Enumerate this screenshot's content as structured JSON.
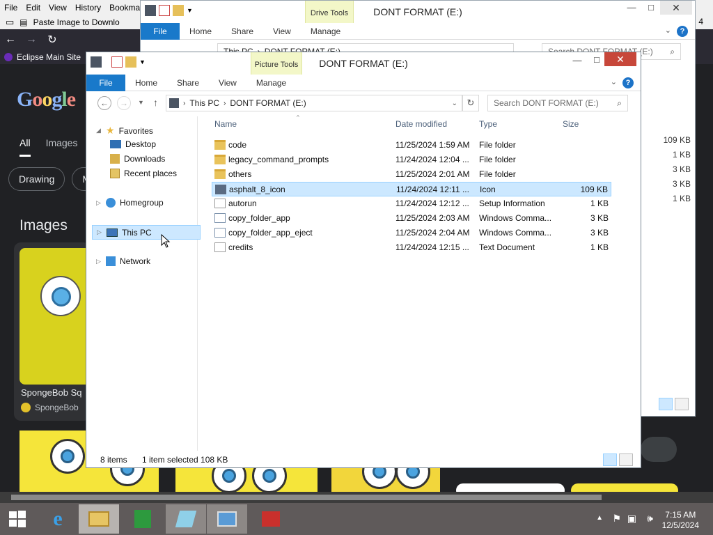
{
  "browser": {
    "menu": [
      "File",
      "Edit",
      "View",
      "History",
      "Bookma"
    ],
    "tab_title": "Paste Image to Downlo",
    "tab_count": "4",
    "bookmark": "Eclipse Main Site",
    "google": {
      "logo": "Google",
      "tabs": [
        "All",
        "Images"
      ],
      "chips": [
        "Drawing",
        "M"
      ],
      "section": "Images",
      "card_caption": "SpongeBob Sq",
      "card_source": "SpongeBob"
    }
  },
  "back_window": {
    "title": "DONT FORMAT (E:)",
    "context_tab": "Drive Tools",
    "ribbon": {
      "file": "File",
      "tabs": [
        "Home",
        "Share",
        "View",
        "Manage"
      ]
    },
    "address": [
      "This PC",
      "DONT FORMAT (E:)"
    ],
    "search_placeholder": "Search DONT FORMAT (E:)",
    "sizes": [
      "109 KB",
      "1 KB",
      "3 KB",
      "3 KB",
      "1 KB"
    ]
  },
  "window": {
    "title": "DONT FORMAT (E:)",
    "context_tab": "Picture Tools",
    "ribbon": {
      "file": "File",
      "tabs": [
        "Home",
        "Share",
        "View",
        "Manage"
      ]
    },
    "address": [
      "This PC",
      "DONT FORMAT (E:)"
    ],
    "search_placeholder": "Search DONT FORMAT (E:)",
    "nav": {
      "favorites": "Favorites",
      "desktop": "Desktop",
      "downloads": "Downloads",
      "recent": "Recent places",
      "homegroup": "Homegroup",
      "thispc": "This PC",
      "network": "Network"
    },
    "columns": {
      "name": "Name",
      "date": "Date modified",
      "type": "Type",
      "size": "Size"
    },
    "files": [
      {
        "name": "code",
        "date": "11/25/2024 1:59 AM",
        "type": "File folder",
        "size": "",
        "icon": "folder-icon"
      },
      {
        "name": "legacy_command_prompts",
        "date": "11/24/2024 12:04 ...",
        "type": "File folder",
        "size": "",
        "icon": "folder-icon"
      },
      {
        "name": "others",
        "date": "11/25/2024 2:01 AM",
        "type": "File folder",
        "size": "",
        "icon": "folder-icon"
      },
      {
        "name": "asphalt_8_icon",
        "date": "11/24/2024 12:11 ...",
        "type": "Icon",
        "size": "109 KB",
        "icon": "image-file-icon"
      },
      {
        "name": "autorun",
        "date": "11/24/2024 12:12 ...",
        "type": "Setup Information",
        "size": "1 KB",
        "icon": "settings-file-icon"
      },
      {
        "name": "copy_folder_app",
        "date": "11/25/2024 2:03 AM",
        "type": "Windows Comma...",
        "size": "3 KB",
        "icon": "cmd-file-icon"
      },
      {
        "name": "copy_folder_app_eject",
        "date": "11/25/2024 2:04 AM",
        "type": "Windows Comma...",
        "size": "3 KB",
        "icon": "cmd-file-icon"
      },
      {
        "name": "credits",
        "date": "11/24/2024 12:15 ...",
        "type": "Text Document",
        "size": "1 KB",
        "icon": "text-file-icon"
      }
    ],
    "status": {
      "count": "8 items",
      "selection": "1 item selected  108 KB"
    }
  },
  "taskbar": {
    "time": "7:15 AM",
    "date": "12/5/2024"
  }
}
